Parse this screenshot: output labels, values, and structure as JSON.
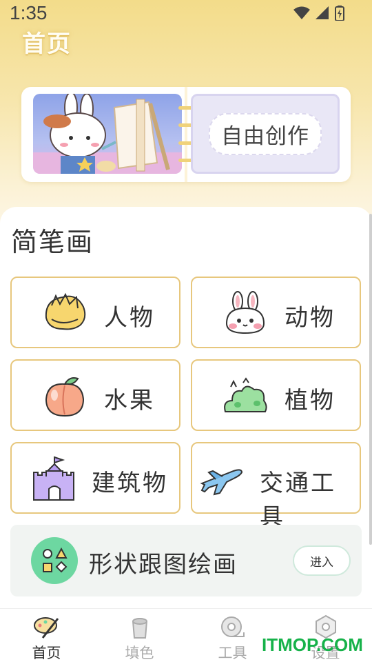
{
  "status_bar": {
    "time": "1:35"
  },
  "header": {
    "title": "首页"
  },
  "free_create": {
    "label": "自由创作"
  },
  "section": {
    "title": "简笔画"
  },
  "categories": [
    {
      "label": "人物",
      "icon": "hair-icon"
    },
    {
      "label": "动物",
      "icon": "bunny-icon"
    },
    {
      "label": "水果",
      "icon": "peach-icon"
    },
    {
      "label": "植物",
      "icon": "bush-icon"
    },
    {
      "label": "建筑物",
      "icon": "castle-icon"
    },
    {
      "label": "交通工具",
      "icon": "airplane-icon"
    }
  ],
  "shape_tracing": {
    "label": "形状跟图绘画",
    "button": "进入",
    "icon": "shapes-icon"
  },
  "nav": [
    {
      "label": "首页",
      "icon": "home-brush-icon",
      "active": true
    },
    {
      "label": "填色",
      "icon": "paint-bucket-icon",
      "active": false
    },
    {
      "label": "工具",
      "icon": "tape-icon",
      "active": false
    },
    {
      "label": "设置",
      "icon": "settings-hexagon-icon",
      "active": false
    }
  ],
  "watermark": "ITMOP.COM",
  "colors": {
    "accent_border": "#e7c77d",
    "green": "#6dd7a1",
    "header_gradient": "#f3dc8a",
    "nav_active": "#333333",
    "nav_inactive": "#aaaaaa"
  }
}
